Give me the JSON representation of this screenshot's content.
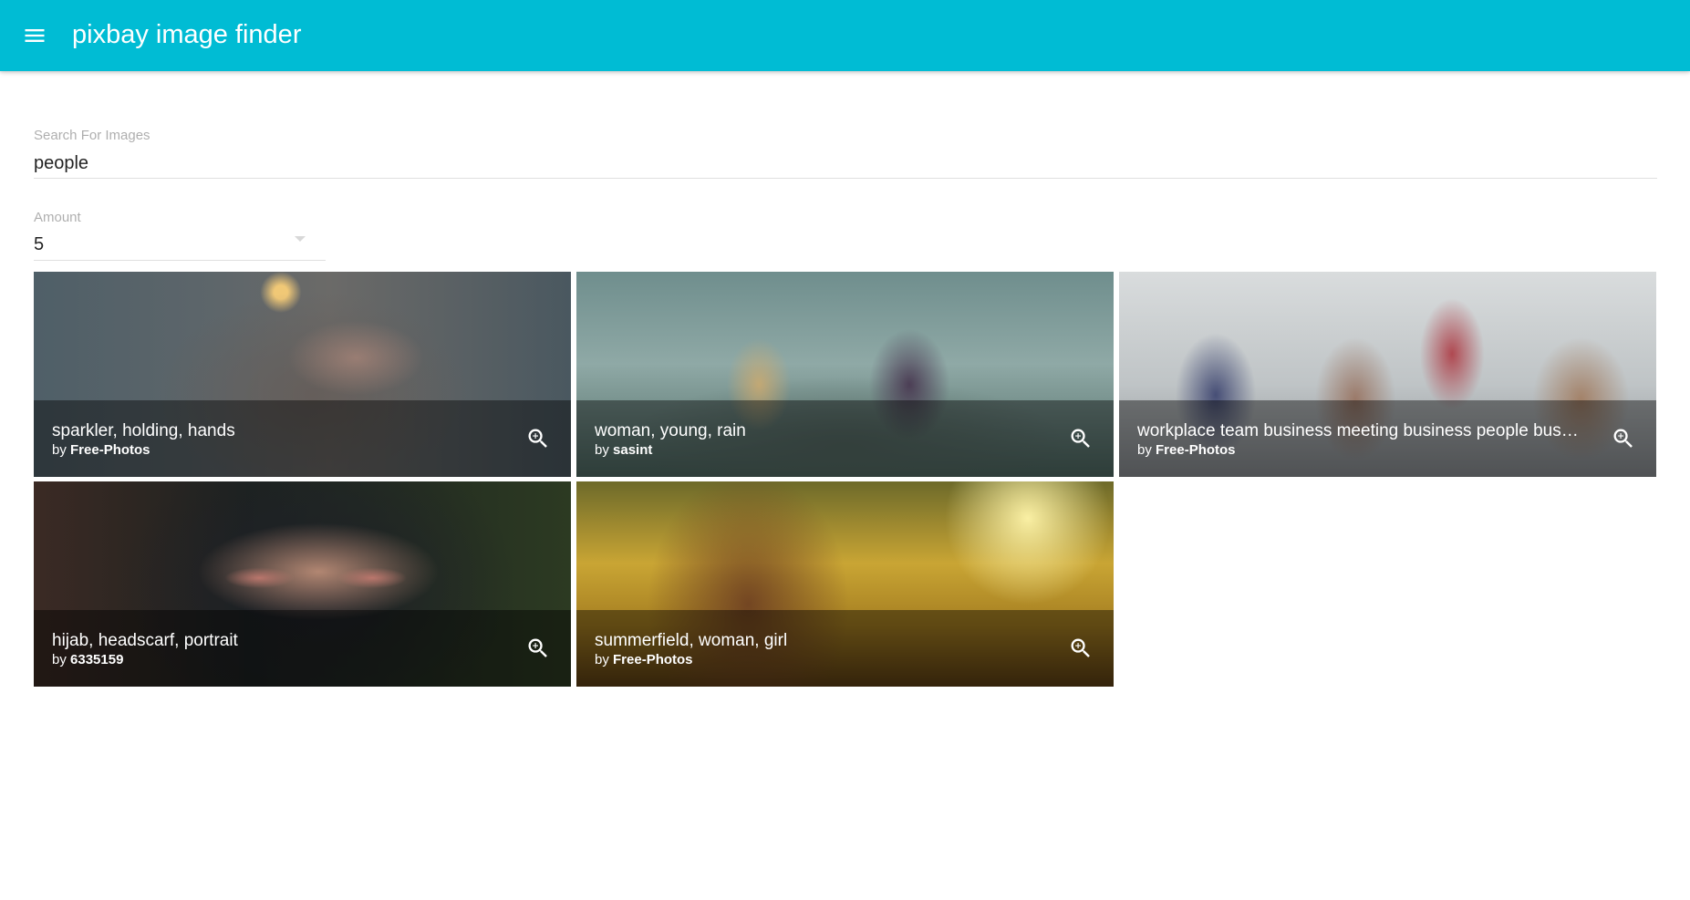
{
  "appbar": {
    "title": "pixbay image finder",
    "menu_icon": "menu-icon",
    "color": "#00bcd4"
  },
  "search": {
    "label": "Search For Images",
    "value": "people"
  },
  "amount": {
    "label": "Amount",
    "value": "5"
  },
  "images": [
    {
      "title": "sparkler, holding, hands",
      "by_prefix": "by",
      "author": "Free-Photos",
      "action_icon": "zoom-in-icon"
    },
    {
      "title": "woman, young, rain",
      "by_prefix": "by",
      "author": "sasint",
      "action_icon": "zoom-in-icon"
    },
    {
      "title": "workplace team business meeting business people bus…",
      "by_prefix": "by",
      "author": "Free-Photos",
      "action_icon": "zoom-in-icon"
    },
    {
      "title": "hijab, headscarf, portrait",
      "by_prefix": "by",
      "author": "6335159",
      "action_icon": "zoom-in-icon"
    },
    {
      "title": "summerfield, woman, girl",
      "by_prefix": "by",
      "author": "Free-Photos",
      "action_icon": "zoom-in-icon"
    }
  ]
}
